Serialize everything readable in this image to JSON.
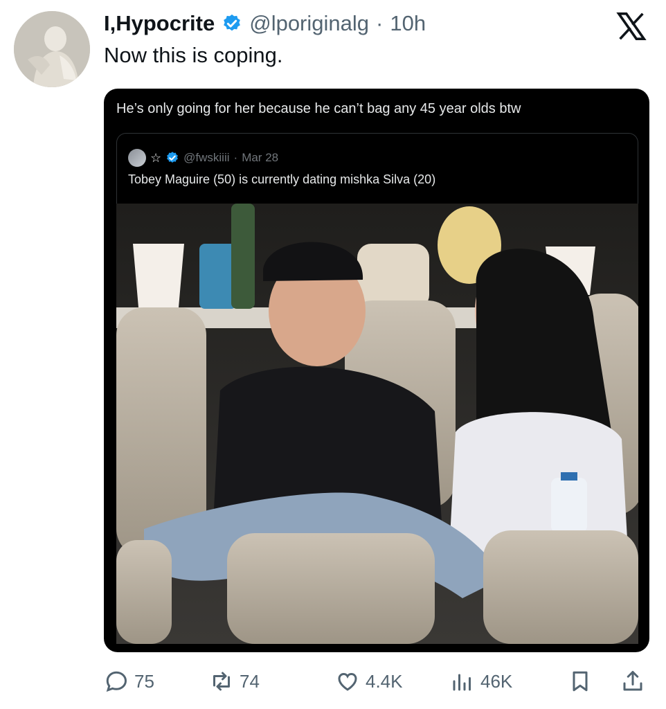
{
  "tweet": {
    "display_name": "I,Hypocrite",
    "handle": "@lporiginalg",
    "separator": "·",
    "time": "10h",
    "text": "Now this is coping."
  },
  "embedded": {
    "text": "He’s only going for her because he can’t bag any 45 year olds btw",
    "quote": {
      "handle": "@fwskiiii",
      "separator": "·",
      "date": "Mar 28",
      "text": "Tobey Maguire (50) is currently dating mishka Silva (20)"
    }
  },
  "actions": {
    "replies": "75",
    "reposts": "74",
    "likes": "4.4K",
    "views": "46K"
  },
  "icons": {
    "verified": "verified-badge-icon",
    "brand": "x-logo-icon"
  },
  "colors": {
    "verified": "#1d9bf0",
    "secondary_text": "#536471",
    "card_bg": "#000000"
  }
}
